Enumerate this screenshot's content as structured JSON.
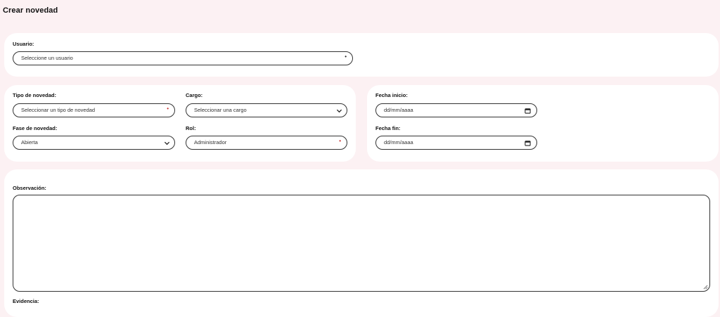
{
  "page": {
    "title": "Crear novedad"
  },
  "usuario": {
    "label": "Usuario:",
    "value": "Seleccione un usuario"
  },
  "tipo_novedad": {
    "label": "Tipo de novedad:",
    "value": "Seleccionar un tipo de novedad"
  },
  "cargo": {
    "label": "Cargo:",
    "value": "Seleccionar una cargo"
  },
  "fase_novedad": {
    "label": "Fase de novedad:",
    "value": "Abierta"
  },
  "rol": {
    "label": "Rol:",
    "value": "Administrador"
  },
  "fecha_inicio": {
    "label": "Fecha inicio:",
    "value": "dd/mm/aaaa"
  },
  "fecha_fin": {
    "label": "Fecha fin:",
    "value": "dd/mm/aaaa"
  },
  "observacion": {
    "label": "Observación:",
    "value": ""
  },
  "evidencia": {
    "label": "Evidencia:"
  },
  "colors": {
    "page_bg": "#fcf1f3",
    "card_bg": "#ffffff",
    "required_marker": "#c62828",
    "border": "#333333"
  },
  "icons": [
    "required-marker",
    "chevron-down-icon",
    "calendar-icon",
    "resize-grip-icon"
  ]
}
